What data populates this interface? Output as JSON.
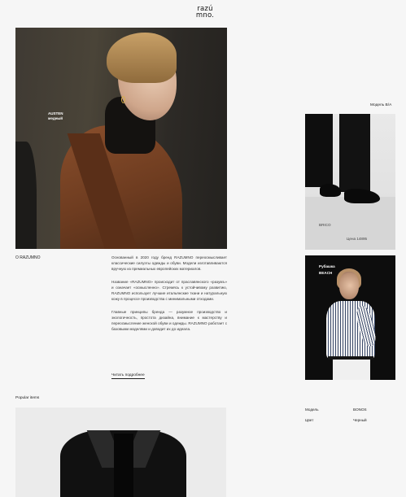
{
  "header": {
    "logo_line1": "razú",
    "logo_line2": "mno."
  },
  "hero": {
    "tag_line1": "AUSTEN",
    "tag_line2": "медный"
  },
  "about": {
    "title": "О RAZUMNO",
    "paragraphs": [
      "Основанный в 2020 году бренд RAZUMNO переосмысливает классические силуэты одежды и обуви. Модели изготавливаются вручную из премиальных европейских материалов.",
      "Название «RAZUMNO» происходит от праславянского «разумъ» и означает «осмысленно». Стремясь к устойчивому развитию, RAZUMNO использует лучшие итальянские ткани и натуральную кожу в процессе производства с минимальными отходами.",
      "Главные принципы бренда — разумное производство и экологичность, простота дизайна, внимание к мастерству и переосмысление женской обуви и одежды. RAZUMNO работает с базовыми моделями и доводит их до идеала."
    ],
    "read_more": "Читать подробнее"
  },
  "popular": {
    "title": "Popular items"
  },
  "sidebar": {
    "model_label": "Модель В/А",
    "shoes": {
      "name": "BRICO",
      "price": "Цена 14895"
    },
    "shirt": {
      "tag_line1": "Рубашка",
      "tag_line2": "BEACH"
    },
    "specs": {
      "model_key": "Модель",
      "model_value": "BONOS",
      "color_key": "Цвет",
      "color_value": "Черный"
    }
  }
}
